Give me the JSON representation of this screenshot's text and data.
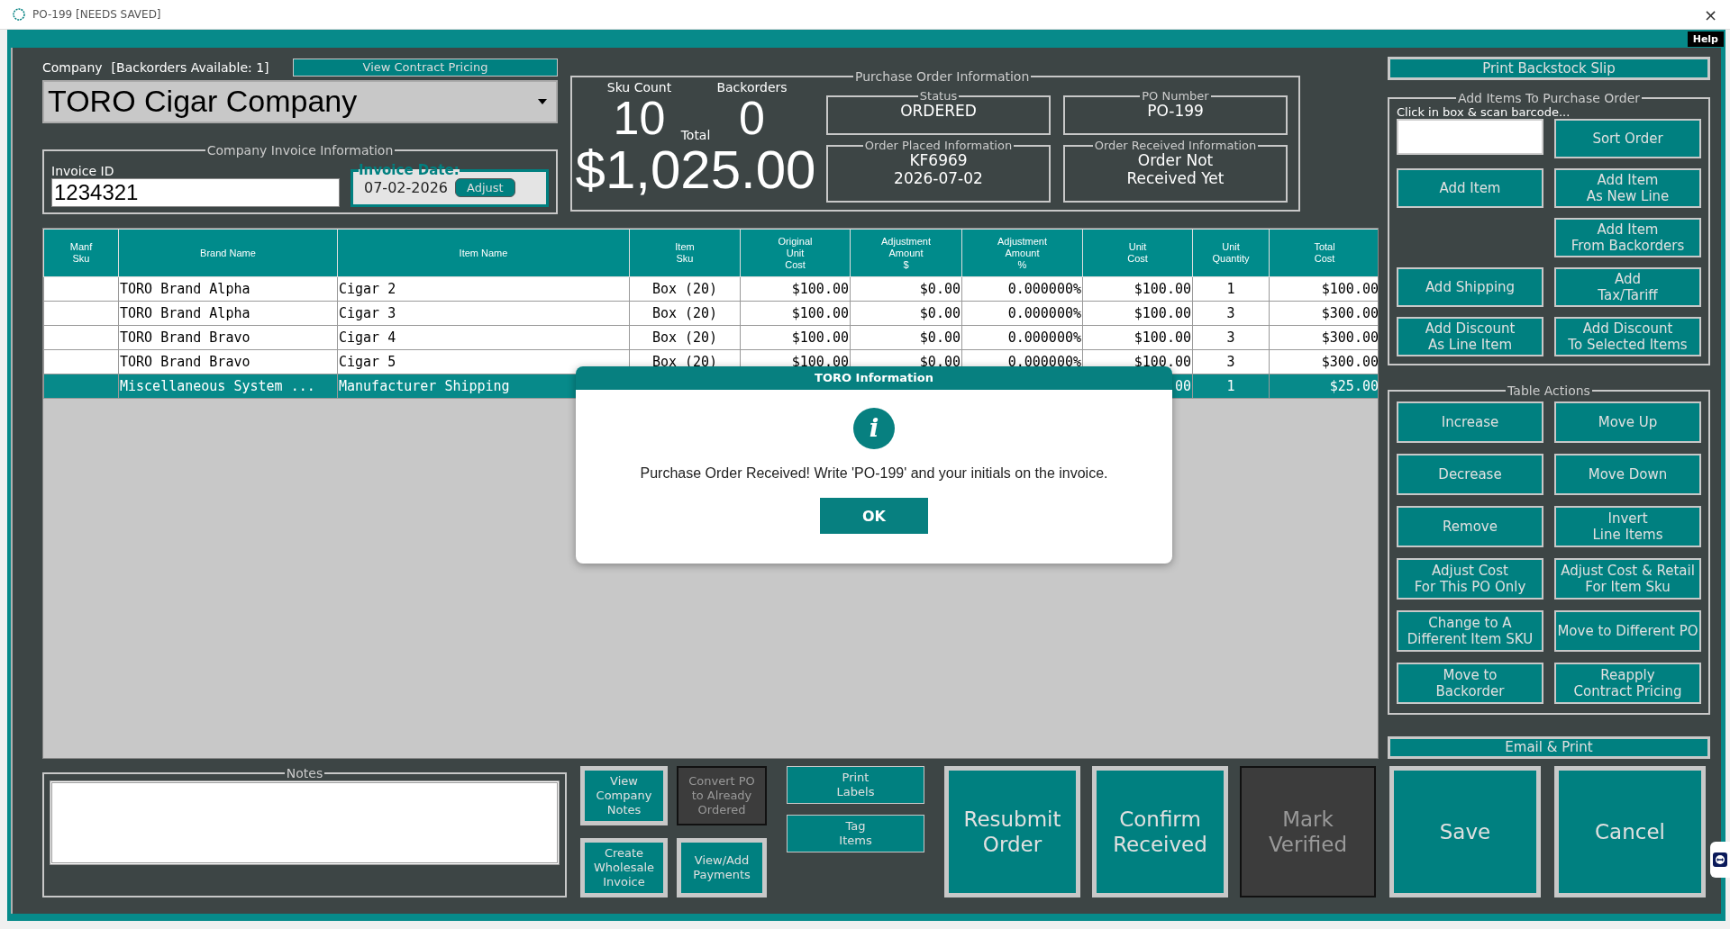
{
  "window": {
    "title": "PO-199 [NEEDS SAVED]",
    "close": "×"
  },
  "menu_bar": {
    "help": "Help"
  },
  "company": {
    "label": "Company",
    "backorders_note": "[Backorders Available: 1]",
    "view_contract_pricing": "View Contract Pricing",
    "value": "TORO Cigar Company"
  },
  "invoice": {
    "legend": "Company Invoice Information",
    "id_label": "Invoice ID",
    "id_value": "1234321",
    "date_label": "Invoice Date:",
    "date_value": "07-02-2026",
    "adjust": "Adjust"
  },
  "po_info": {
    "legend": "Purchase Order Information",
    "sku_count_label": "Sku Count",
    "sku_count": "10",
    "backorders_label": "Backorders",
    "backorders": "0",
    "total_label": "Total",
    "total": "$1,025.00",
    "boxes": [
      {
        "legend": "Status",
        "lines": [
          "ORDERED"
        ]
      },
      {
        "legend": "PO Number",
        "lines": [
          "PO-199"
        ]
      },
      {
        "legend": "Order Placed Information",
        "lines": [
          "KF6969",
          "2026-07-02"
        ]
      },
      {
        "legend": "Order Received Information",
        "lines": [
          "Order Not",
          "Received Yet"
        ]
      }
    ]
  },
  "table": {
    "columns": [
      "Manf\nSku",
      "Brand Name",
      "Item Name",
      "Item\nSku",
      "Original\nUnit\nCost",
      "Adjustment\nAmount\n$",
      "Adjustment\nAmount\n%",
      "Unit\nCost",
      "Unit\nQuantity",
      "Total\nCost"
    ],
    "rows": [
      {
        "brand": "TORO Brand Alpha",
        "item": "Cigar 2",
        "sku": "Box (20)",
        "orig": "$100.00",
        "adj_amt": "$0.00",
        "adj_pct": "0.000000%",
        "unit_cost": "$100.00",
        "qty": "1",
        "total": "$100.00",
        "selected": false
      },
      {
        "brand": "TORO Brand Alpha",
        "item": "Cigar 3",
        "sku": "Box (20)",
        "orig": "$100.00",
        "adj_amt": "$0.00",
        "adj_pct": "0.000000%",
        "unit_cost": "$100.00",
        "qty": "3",
        "total": "$300.00",
        "selected": false
      },
      {
        "brand": "TORO Brand Bravo",
        "item": "Cigar 4",
        "sku": "Box (20)",
        "orig": "$100.00",
        "adj_amt": "$0.00",
        "adj_pct": "0.000000%",
        "unit_cost": "$100.00",
        "qty": "3",
        "total": "$300.00",
        "selected": false
      },
      {
        "brand": "TORO Brand Bravo",
        "item": "Cigar 5",
        "sku": "Box (20)",
        "orig": "$100.00",
        "adj_amt": "$0.00",
        "adj_pct": "0.000000%",
        "unit_cost": "$100.00",
        "qty": "3",
        "total": "$300.00",
        "selected": false
      },
      {
        "brand": "Miscellaneous System ...",
        "item": "Manufacturer Shipping",
        "unit_cost": "00",
        "qty": "1",
        "total": "$25.00",
        "selected": true
      }
    ]
  },
  "side_panel": {
    "print_backstock": "Print Backstock Slip",
    "add_items": {
      "legend": "Add Items To Purchase Order",
      "scan_hint": "Click in box & scan barcode...",
      "buttons": [
        "Sort Order",
        "Add Item",
        "Add Item\nAs New Line",
        "Add Item\nFrom Backorders",
        "Add Shipping",
        "Add\nTax/Tariff",
        "Add Discount\nAs Line Item",
        "Add Discount\nTo Selected Items"
      ]
    },
    "table_actions": {
      "legend": "Table Actions",
      "buttons": [
        "Increase",
        "Move Up",
        "Decrease",
        "Move Down",
        "Remove",
        "Invert\nLine Items",
        "Adjust Cost\nFor This PO Only",
        "Adjust Cost & Retail\nFor Item Sku",
        "Change to A\nDifferent Item SKU",
        "Move to Different PO",
        "Move to\nBackorder",
        "Reapply\nContract Pricing"
      ]
    },
    "email_print": "Email & Print"
  },
  "bottom": {
    "notes_legend": "Notes",
    "small_buttons": [
      {
        "label": "View\nCompany\nNotes",
        "disabled": false
      },
      {
        "label": "Convert PO\nto Already\nOrdered",
        "disabled": true
      },
      {
        "label": "Create\nWholesale\nInvoice",
        "disabled": false
      },
      {
        "label": "View/Add\nPayments",
        "disabled": false
      }
    ],
    "print_buttons": [
      "Print\nLabels",
      "Tag\nItems"
    ],
    "big_buttons": [
      {
        "label": "Resubmit\nOrder",
        "disabled": false
      },
      {
        "label": "Confirm\nReceived",
        "disabled": false
      },
      {
        "label": "Mark\nVerified",
        "disabled": true
      },
      {
        "label": "Save",
        "disabled": false
      },
      {
        "label": "Cancel",
        "disabled": false
      }
    ]
  },
  "dialog": {
    "title": "TORO Information",
    "icon": "i",
    "message": "Purchase Order Received! Write 'PO-199' and your initials on the invoice.",
    "ok": "OK"
  }
}
